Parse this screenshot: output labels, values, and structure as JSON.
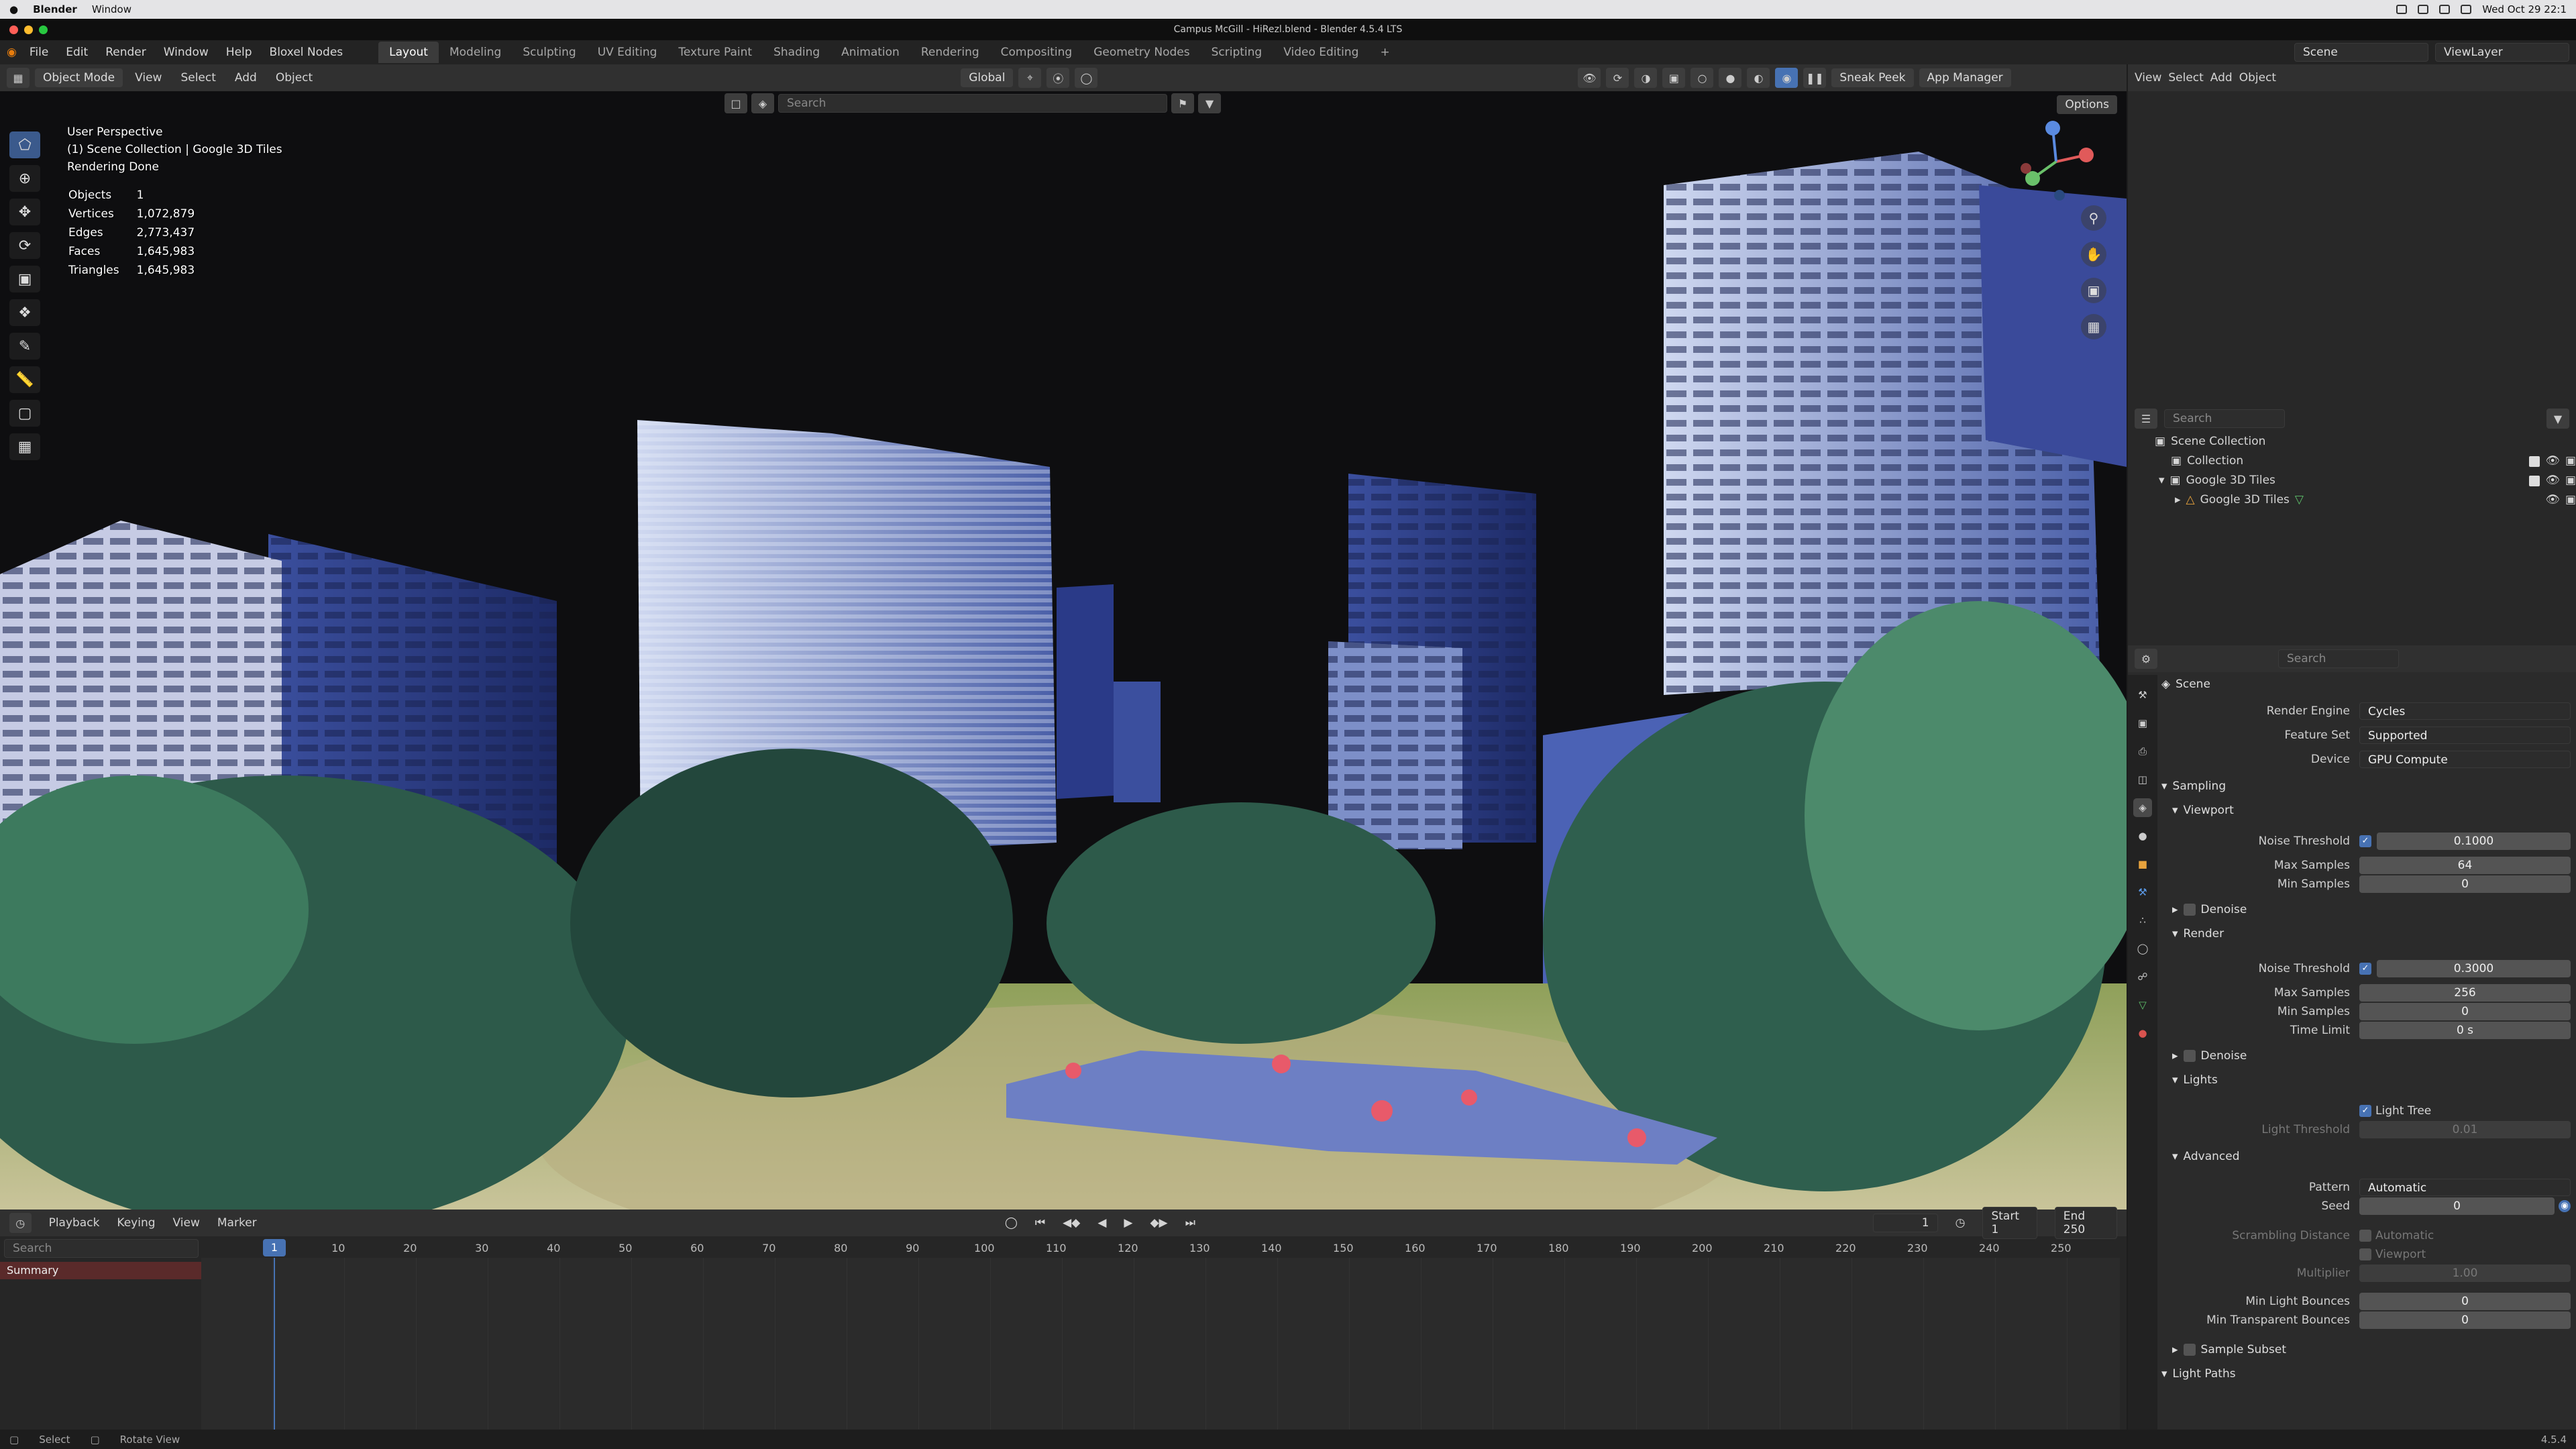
{
  "macbar": {
    "app": "Blender",
    "menu": "Window",
    "clock": "Wed Oct 29 22:1"
  },
  "title": "Campus McGill - HiRezl.blend - Blender 4.5.4 LTS",
  "menu": [
    "File",
    "Edit",
    "Render",
    "Window",
    "Help",
    "Bloxel Nodes"
  ],
  "workspaces": [
    "Layout",
    "Modeling",
    "Sculpting",
    "UV Editing",
    "Texture Paint",
    "Shading",
    "Animation",
    "Rendering",
    "Compositing",
    "Geometry Nodes",
    "Scripting",
    "Video Editing"
  ],
  "scene": "Scene",
  "view_layer": "ViewLayer",
  "header": {
    "mode": "Object Mode",
    "items": [
      "View",
      "Select",
      "Add",
      "Object"
    ],
    "transform": "Global",
    "sneak": "Sneak Peek",
    "appman": "App Manager",
    "outliner_menu": [
      "View",
      "Select",
      "Add",
      "Object"
    ]
  },
  "viewport": {
    "search_placeholder": "Search",
    "options": "Options",
    "perspective": "User Perspective",
    "collection": "(1) Scene Collection | Google 3D Tiles",
    "status": "Rendering Done",
    "stats": [
      {
        "k": "Objects",
        "v": "1"
      },
      {
        "k": "Vertices",
        "v": "1,072,879"
      },
      {
        "k": "Edges",
        "v": "2,773,437"
      },
      {
        "k": "Faces",
        "v": "1,645,983"
      },
      {
        "k": "Triangles",
        "v": "1,645,983"
      }
    ]
  },
  "timeline": {
    "menus": [
      "Playback",
      "Keying",
      "View",
      "Marker"
    ],
    "frame": "1",
    "start_label": "Start",
    "start": "1",
    "end_label": "End",
    "end": "250",
    "search_placeholder": "Search",
    "summary": "Summary",
    "ticks": [
      "10",
      "20",
      "30",
      "40",
      "50",
      "60",
      "70",
      "80",
      "90",
      "100",
      "110",
      "120",
      "130",
      "140",
      "150",
      "160",
      "170",
      "180",
      "190",
      "200",
      "210",
      "220",
      "230",
      "240",
      "250"
    ],
    "current": "1"
  },
  "status": {
    "select": "Select",
    "rotate": "Rotate View",
    "version": "4.5.4"
  },
  "outliner": {
    "search_placeholder": "Search",
    "items": [
      "Scene Collection",
      "Collection",
      "Google 3D Tiles",
      "Google 3D Tiles"
    ]
  },
  "props": {
    "search_placeholder": "Search",
    "context": "Scene",
    "render_engine": {
      "label": "Render Engine",
      "value": "Cycles"
    },
    "feature_set": {
      "label": "Feature Set",
      "value": "Supported"
    },
    "device": {
      "label": "Device",
      "value": "GPU Compute"
    },
    "sampling": "Sampling",
    "viewport": "Viewport",
    "render": "Render",
    "denoise": "Denoise",
    "lights": "Lights",
    "advanced": "Advanced",
    "sample_subset": "Sample Subset",
    "light_paths": "Light Paths",
    "vp_noise": {
      "label": "Noise Threshold",
      "value": "0.1000"
    },
    "vp_max": {
      "label": "Max Samples",
      "value": "64"
    },
    "vp_min": {
      "label": "Min Samples",
      "value": "0"
    },
    "r_noise": {
      "label": "Noise Threshold",
      "value": "0.3000"
    },
    "r_max": {
      "label": "Max Samples",
      "value": "256"
    },
    "r_min": {
      "label": "Min Samples",
      "value": "0"
    },
    "r_time": {
      "label": "Time Limit",
      "value": "0 s"
    },
    "light_tree": "Light Tree",
    "light_threshold": {
      "label": "Light Threshold",
      "value": "0.01"
    },
    "pattern": {
      "label": "Pattern",
      "value": "Automatic"
    },
    "seed": {
      "label": "Seed",
      "value": "0"
    },
    "scrambling": {
      "label": "Scrambling Distance",
      "value": "Automatic"
    },
    "scr_viewport": "Viewport",
    "multiplier": {
      "label": "Multiplier",
      "value": "1.00"
    },
    "min_light": {
      "label": "Min Light Bounces",
      "value": "0"
    },
    "min_trans": {
      "label": "Min Transparent Bounces",
      "value": "0"
    }
  }
}
